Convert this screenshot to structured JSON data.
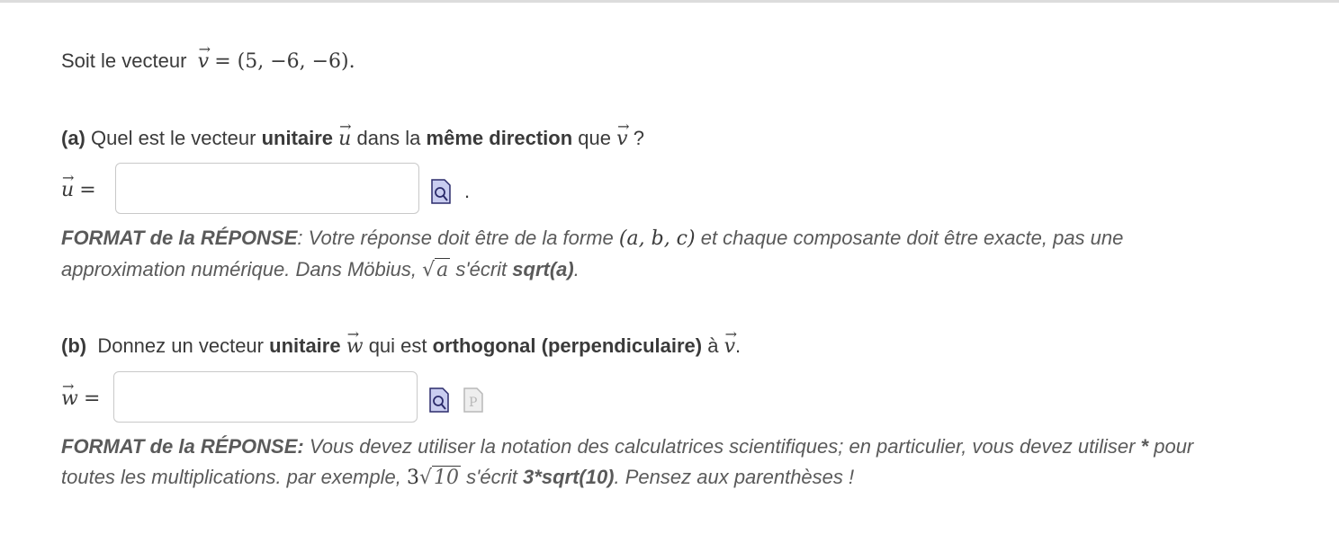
{
  "intro": {
    "text": "Soit le vecteur",
    "vector_name": "v",
    "vector_value": "= (5, −6, −6)."
  },
  "part_a": {
    "label": "(a)",
    "q1": "Quel est le vecteur",
    "q_bold1": "unitaire",
    "q_vec": "u",
    "q2": "dans la",
    "q_bold2": "même direction",
    "q3": "que",
    "q_vec2": "v",
    "q4": "?",
    "answer_var": "u",
    "answer_eq": "=",
    "answer_value": "",
    "period": ".",
    "format_bold": "FORMAT de la RÉPONSE",
    "format_text1": ": Votre réponse doit être de la forme",
    "format_math": "(a, b, c)",
    "format_text2": "et chaque composante doit être exacte, pas une",
    "format_line2_a": "approximation numérique.  Dans Möbius,",
    "format_sqrt": "a",
    "format_line2_b": "s'écrit",
    "format_line2_bold": "sqrt(a)",
    "format_line2_end": "."
  },
  "part_b": {
    "label": "(b)",
    "q1": "Donnez un vecteur",
    "q_bold1": "unitaire",
    "q_vec": "w",
    "q2": "qui est",
    "q_bold2": "orthogonal (perpendiculaire)",
    "q3": "à",
    "q_vec2": "v",
    "q4": ".",
    "answer_var": "w",
    "answer_eq": "=",
    "answer_value": "",
    "format_bold": "FORMAT de la RÉPONSE:",
    "format_text1": "Vous devez utiliser la notation des calculatrices scientifiques; en particulier, vous devez utiliser",
    "format_star": "*",
    "format_text2": "pour",
    "format_line2_a": "toutes les multiplications. par exemple,",
    "format_math_coef": "3",
    "format_sqrt": "10",
    "format_line2_b": "s'écrit",
    "format_line2_bold": "3*sqrt(10)",
    "format_line2_end": ".  Pensez aux parenthèses !"
  },
  "icons": {
    "preview": "preview-icon",
    "palette": "palette-icon"
  },
  "colors": {
    "icon_fill": "#c9cdf0",
    "icon_stroke": "#2b2b6b",
    "input_border": "#c9c9c9"
  }
}
